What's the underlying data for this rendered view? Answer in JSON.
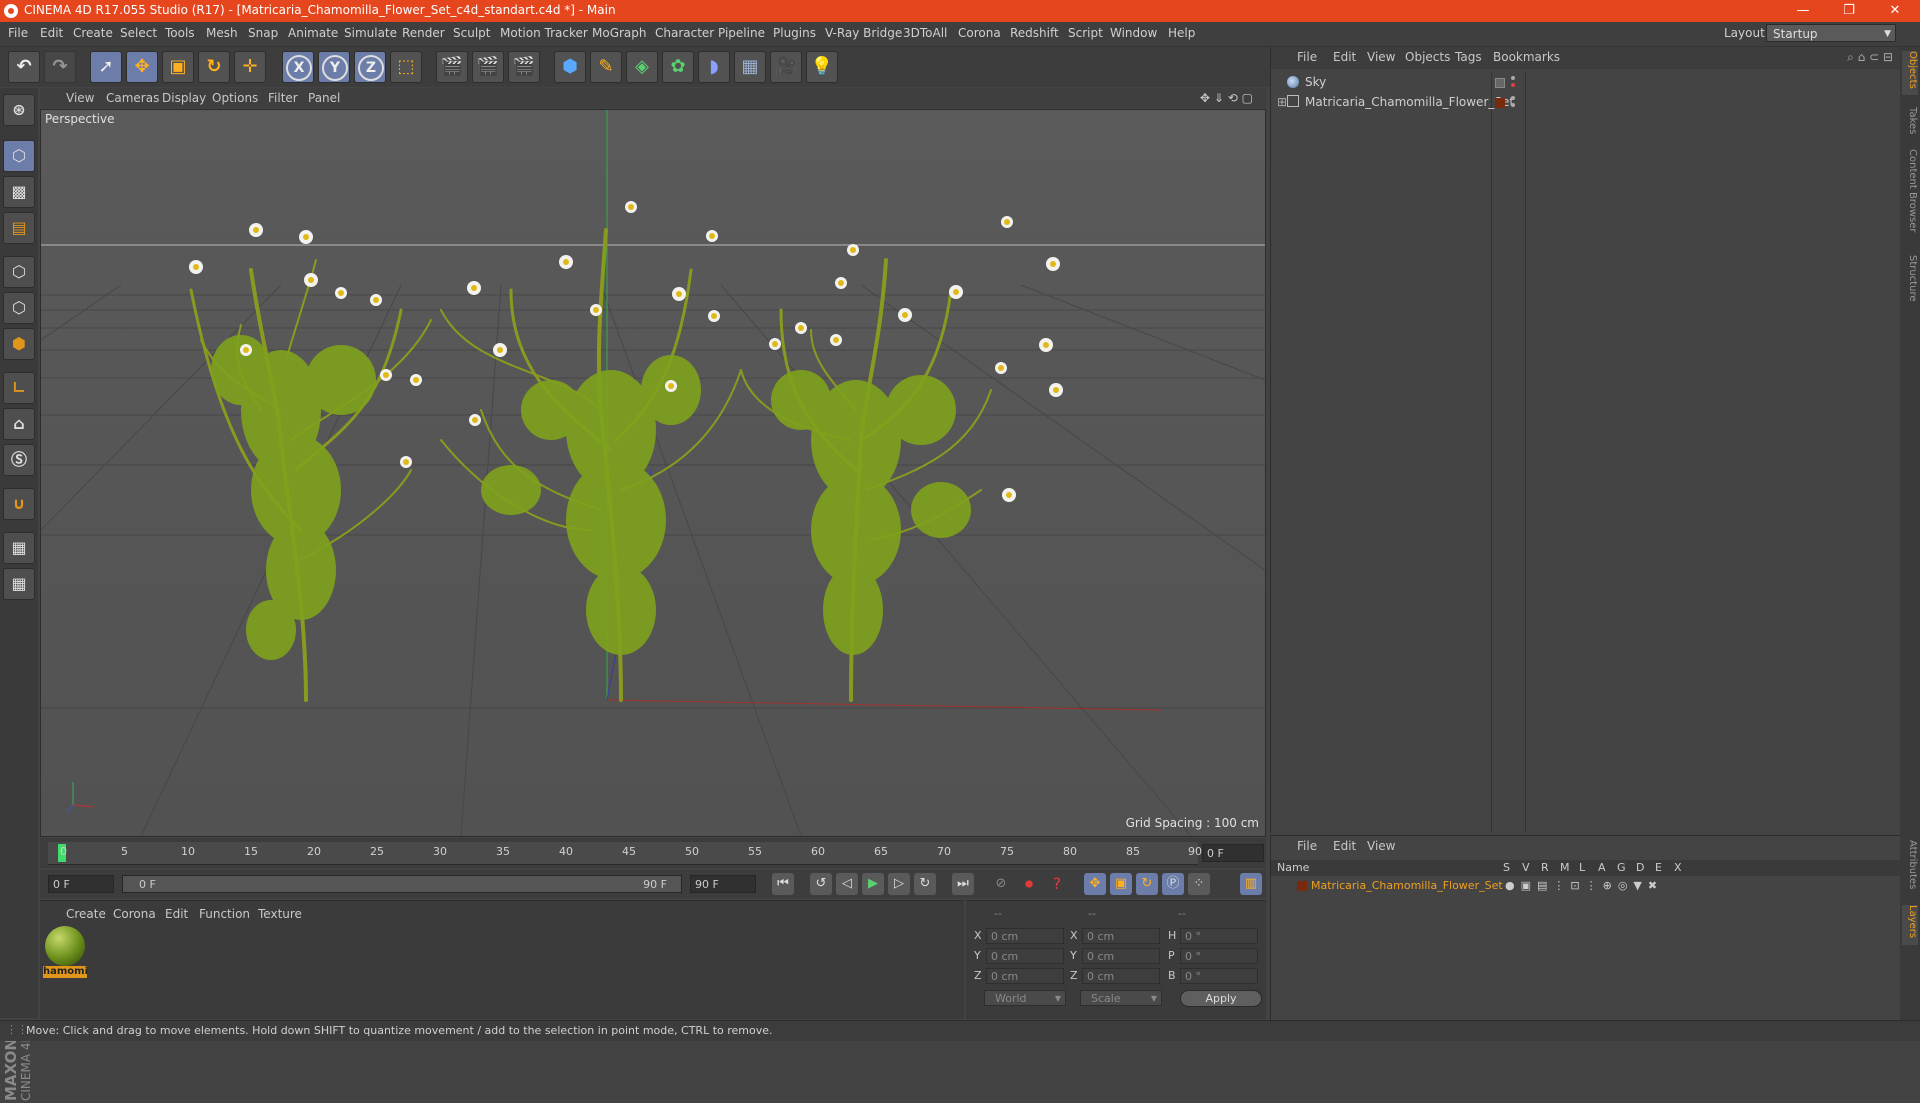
{
  "window": {
    "title": "CINEMA 4D R17.055 Studio (R17) - [Matricaria_Chamomilla_Flower_Set_c4d_standart.c4d *] - Main",
    "minimize": "—",
    "restore": "❐",
    "close": "✕"
  },
  "menubar": {
    "items": [
      "File",
      "Edit",
      "Create",
      "Select",
      "Tools",
      "Mesh",
      "Snap",
      "Animate",
      "Simulate",
      "Render",
      "Sculpt",
      "Motion Tracker",
      "MoGraph",
      "Character",
      "Pipeline",
      "Plugins",
      "V-Ray Bridge",
      "3DToAll",
      "Corona",
      "Redshift",
      "Script",
      "Window",
      "Help"
    ],
    "layout_label": "Layout:",
    "layout_value": "Startup"
  },
  "axis_buttons": [
    "X",
    "Y",
    "Z"
  ],
  "viewport": {
    "menu": [
      "View",
      "Cameras",
      "Display",
      "Options",
      "Filter",
      "Panel"
    ],
    "label": "Perspective",
    "grid_spacing": "Grid Spacing : 100 cm"
  },
  "timeline": {
    "ticks": [
      "0",
      "5",
      "10",
      "15",
      "20",
      "25",
      "30",
      "35",
      "40",
      "45",
      "50",
      "55",
      "60",
      "65",
      "70",
      "75",
      "80",
      "85",
      "90"
    ],
    "current_frame": "0 F",
    "range_start": "0 F",
    "range_bar_start": "0 F",
    "range_bar_end": "90 F",
    "range_end": "90 F"
  },
  "material_manager": {
    "menu": [
      "Create",
      "Corona",
      "Edit",
      "Function",
      "Texture"
    ],
    "material_name": "hamomi"
  },
  "coordinates": {
    "headers": [
      "--",
      "--",
      "--"
    ],
    "rows": [
      {
        "a": "X",
        "av": "0 cm",
        "b": "X",
        "bv": "0 cm",
        "c": "H",
        "cv": "0 °"
      },
      {
        "a": "Y",
        "av": "0 cm",
        "b": "Y",
        "bv": "0 cm",
        "c": "P",
        "cv": "0 °"
      },
      {
        "a": "Z",
        "av": "0 cm",
        "b": "Z",
        "bv": "0 cm",
        "c": "B",
        "cv": "0 °"
      }
    ],
    "space": "World",
    "mode": "Scale",
    "apply": "Apply"
  },
  "object_manager": {
    "menu": [
      "File",
      "Edit",
      "View",
      "Objects",
      "Tags",
      "Bookmarks"
    ],
    "objects": [
      {
        "name": "Sky"
      },
      {
        "name": "Matricaria_Chamomilla_Flower_Set"
      }
    ]
  },
  "layer_manager": {
    "menu": [
      "File",
      "Edit",
      "View"
    ],
    "name_header": "Name",
    "columns": [
      "S",
      "V",
      "R",
      "M",
      "L",
      "A",
      "G",
      "D",
      "E",
      "X"
    ],
    "layer_name": "Matricaria_Chamomilla_Flower_Set",
    "layer_color": "#7a2a0c"
  },
  "right_tabs": [
    "Objects",
    "Takes",
    "Content Browser",
    "Structure",
    "Attributes",
    "Layers"
  ],
  "status": "Move: Click and drag to move elements. Hold down SHIFT to quantize movement / add to the selection in point mode, CTRL to remove.",
  "maxon": {
    "brand": "MAXON",
    "product": "CINEMA 4D"
  },
  "colors": {
    "titlebar": "#e5461d",
    "accent": "#f0a020",
    "active_button": "#6b7da8"
  }
}
